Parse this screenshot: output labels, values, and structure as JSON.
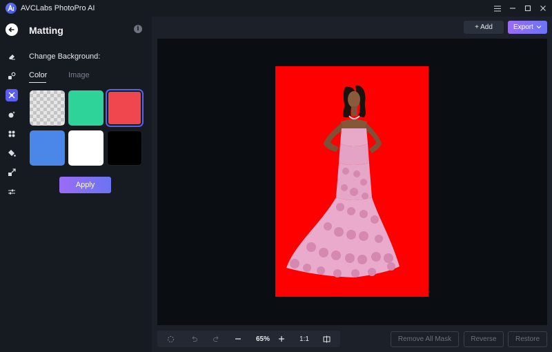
{
  "app": {
    "title": "AVCLabs PhotoPro AI"
  },
  "window_controls": [
    "menu-icon",
    "minimize-icon",
    "maximize-icon",
    "close-icon"
  ],
  "rail": {
    "back_icon": "back-arrow-icon",
    "tools": [
      {
        "icon": "eraser-icon",
        "active": false
      },
      {
        "icon": "replace-object-icon",
        "active": false
      },
      {
        "icon": "matting-icon",
        "active": true
      },
      {
        "icon": "enhance-icon",
        "active": false
      },
      {
        "icon": "face-icon",
        "active": false
      },
      {
        "icon": "colorize-icon",
        "active": false
      },
      {
        "icon": "upscale-icon",
        "active": false
      },
      {
        "icon": "adjust-icon",
        "active": false
      }
    ]
  },
  "panel": {
    "title": "Matting",
    "info_symbol": "i",
    "section_label": "Change Background:",
    "tabs": [
      {
        "label": "Color",
        "active": true
      },
      {
        "label": "Image",
        "active": false
      }
    ],
    "swatches": [
      {
        "name": "transparent",
        "color": "transparent",
        "selected": false
      },
      {
        "name": "green",
        "color": "#2ed399",
        "selected": false
      },
      {
        "name": "red",
        "color": "#f0474f",
        "selected": true
      },
      {
        "name": "blue",
        "color": "#4b87e8",
        "selected": false
      },
      {
        "name": "white",
        "color": "#ffffff",
        "selected": false
      },
      {
        "name": "black",
        "color": "#000000",
        "selected": false
      }
    ],
    "apply_label": "Apply"
  },
  "top_actions": {
    "add_label": "+ Add",
    "export_label": "Export"
  },
  "canvas": {
    "background_color": "#ff0000",
    "subject": "woman in pink ruffled gown"
  },
  "zoom_toolbar": {
    "zoom_value": "65%",
    "ratio_label": "1:1"
  },
  "actions": {
    "remove_all_mask": "Remove All Mask",
    "reverse": "Reverse",
    "restore": "Restore"
  },
  "colors": {
    "accent": "#5b5ef0",
    "gradient_start": "#9a6cf5",
    "gradient_end": "#6b74f2"
  }
}
